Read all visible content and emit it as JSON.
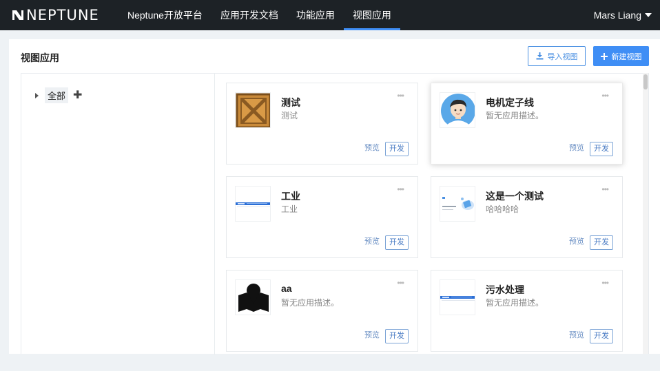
{
  "brand": {
    "name": "NEPTUNE"
  },
  "nav": {
    "items": [
      {
        "label": "Neptune开放平台",
        "active": false
      },
      {
        "label": "应用开发文档",
        "active": false
      },
      {
        "label": "功能应用",
        "active": false
      },
      {
        "label": "视图应用",
        "active": true
      }
    ]
  },
  "user": {
    "name": "Mars Liang"
  },
  "page": {
    "title": "视图应用",
    "import_label": "导入视图",
    "new_label": "新建视图"
  },
  "tree": {
    "root_label": "全部",
    "add_symbol": "✚"
  },
  "cards": [
    {
      "title": "测试",
      "desc": "测试",
      "thumb": "crate-icon",
      "preview": "预览",
      "dev": "开发",
      "more": "•••"
    },
    {
      "title": "电机定子线",
      "desc": "暂无应用描述。",
      "thumb": "avatar-icon",
      "preview": "预览",
      "dev": "开发",
      "more": "•••"
    },
    {
      "title": "工业",
      "desc": "工业",
      "thumb": "screenshot-icon",
      "preview": "预览",
      "dev": "开发",
      "more": "•••"
    },
    {
      "title": "这是一个测试",
      "desc": "哈哈哈哈",
      "thumb": "cloud-illustration-icon",
      "preview": "预览",
      "dev": "开发",
      "more": "•••"
    },
    {
      "title": "aa",
      "desc": "暂无应用描述。",
      "thumb": "map-pin-icon",
      "preview": "预览",
      "dev": "开发",
      "more": "•••"
    },
    {
      "title": "污水处理",
      "desc": "暂无应用描述。",
      "thumb": "screenshot-icon",
      "preview": "预览",
      "dev": "开发",
      "more": "•••"
    }
  ],
  "colors": {
    "nav_bg": "#1d2226",
    "accent": "#3f8ef5",
    "page_bg": "#eef2f5"
  }
}
